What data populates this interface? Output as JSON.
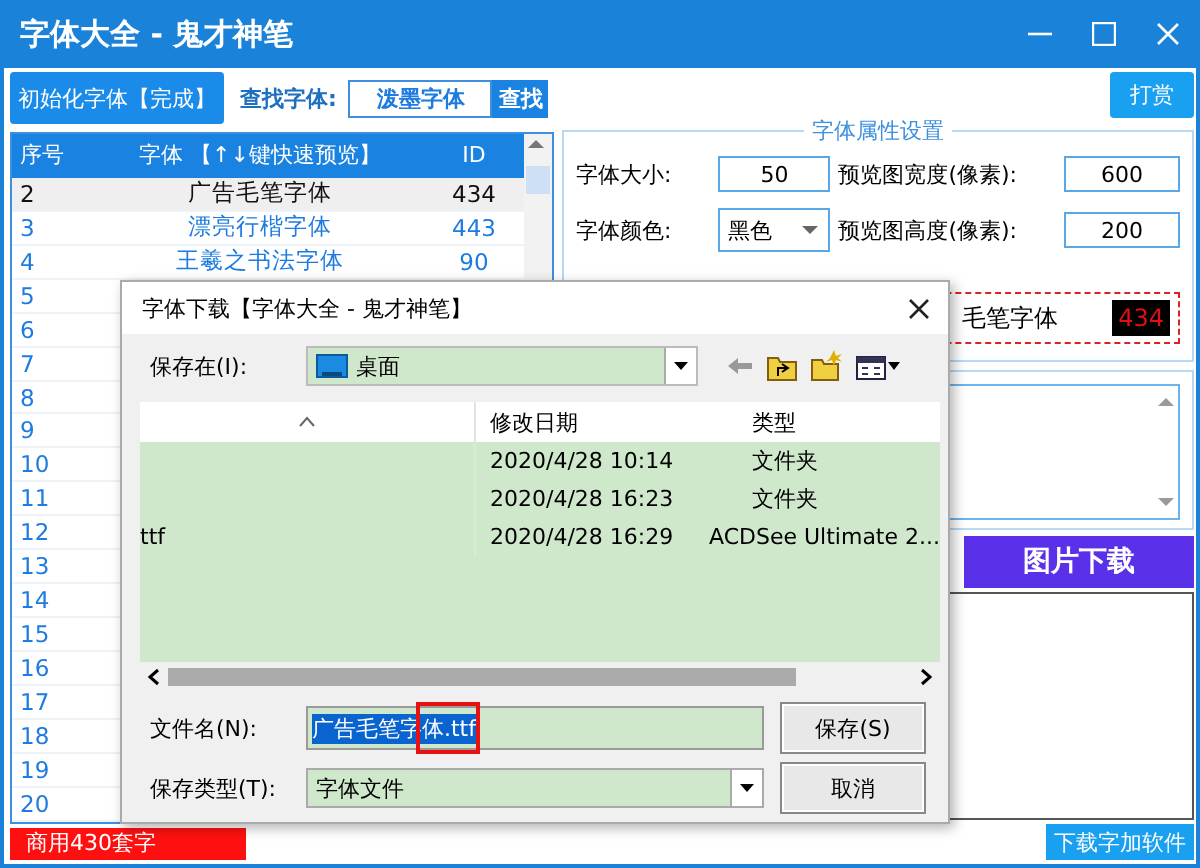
{
  "window": {
    "title": "字体大全 - 鬼才神笔"
  },
  "search_bar": {
    "init_button": "初始化字体【完成】",
    "label": "查找字体:",
    "value": "泼墨字体",
    "button": "查找"
  },
  "font_list": {
    "columns": [
      "序号",
      "字体 【↑↓键快速预览】",
      "ID"
    ],
    "rows": [
      {
        "number": "2",
        "name": "广告毛笔字体",
        "id": "434",
        "selected": true
      },
      {
        "number": "3",
        "name": "漂亮行楷字体",
        "id": "443",
        "selected": false
      },
      {
        "number": "4",
        "name": "王羲之书法字体",
        "id": "90",
        "selected": false
      },
      {
        "number": "5",
        "selected": false
      },
      {
        "number": "6",
        "selected": false
      },
      {
        "number": "7",
        "selected": false
      },
      {
        "number": "8",
        "selected": false
      },
      {
        "number": "9",
        "selected": false
      },
      {
        "number": "10",
        "selected": false
      },
      {
        "number": "11",
        "selected": false
      },
      {
        "number": "12",
        "selected": false
      },
      {
        "number": "13",
        "selected": false
      },
      {
        "number": "14",
        "selected": false
      },
      {
        "number": "15",
        "selected": false
      },
      {
        "number": "16",
        "selected": false
      },
      {
        "number": "17",
        "selected": false
      },
      {
        "number": "18",
        "selected": false
      },
      {
        "number": "19",
        "selected": false
      },
      {
        "number": "20",
        "selected": false
      }
    ]
  },
  "promo_bar": "商用430套字",
  "reward_button": "打赏",
  "properties": {
    "title": "字体属性设置",
    "fields": [
      {
        "label": "字体大小:",
        "value": "50",
        "kind": "text"
      },
      {
        "label": "预览图宽度(像素):",
        "value": "600",
        "kind": "text"
      },
      {
        "label": "字体颜色:",
        "value": "黑色",
        "kind": "dropdown"
      },
      {
        "label": "预览图高度(像素):",
        "value": "200",
        "kind": "text"
      }
    ],
    "preview": {
      "text": "毛笔字体",
      "id": "434"
    }
  },
  "image_download_button": "图片下载",
  "download_app_button": "下载字加软件",
  "dialog": {
    "title": "字体下载【字体大全 - 鬼才神笔】",
    "save_in_label": "保存在(I):",
    "save_in_value": "桌面",
    "columns": [
      "修改日期",
      "类型"
    ],
    "files": [
      {
        "date": "2020/4/28 10:14",
        "type": "文件夹"
      },
      {
        "date": "2020/4/28 16:23",
        "type": "文件夹"
      },
      {
        "name": "ttf",
        "date": "2020/4/28 16:29",
        "type": "ACDSee Ultimate 2..."
      }
    ],
    "filename_label": "文件名(N):",
    "filename_value": "广告毛笔字体.ttf",
    "filetype_label": "保存类型(T):",
    "filetype_value": "字体文件",
    "save_button": "保存(S)",
    "cancel_button": "取消"
  }
}
